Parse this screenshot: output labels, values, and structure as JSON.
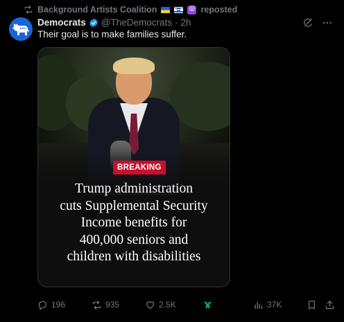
{
  "repost": {
    "account": "Background Artists Coalition",
    "label": "reposted",
    "icon": "repost-icon"
  },
  "post": {
    "display_name": "Democrats",
    "handle": "@TheDemocrats",
    "separator": "·",
    "time": "2h",
    "text": "Their goal is to make families suffer."
  },
  "media": {
    "badge": "BREAKING",
    "headline_lines": [
      "Trump administration",
      "cuts Supplemental Security",
      "Income benefits for",
      "400,000 seniors and",
      "children with disabilities"
    ]
  },
  "actions": {
    "replies": "196",
    "reposts": "935",
    "likes": "2.5K",
    "views": "37K"
  },
  "colors": {
    "accent": "#1d9bf0",
    "badge_red": "#c8102e",
    "muted": "#71767b",
    "grok_green": "#00ba7c"
  }
}
